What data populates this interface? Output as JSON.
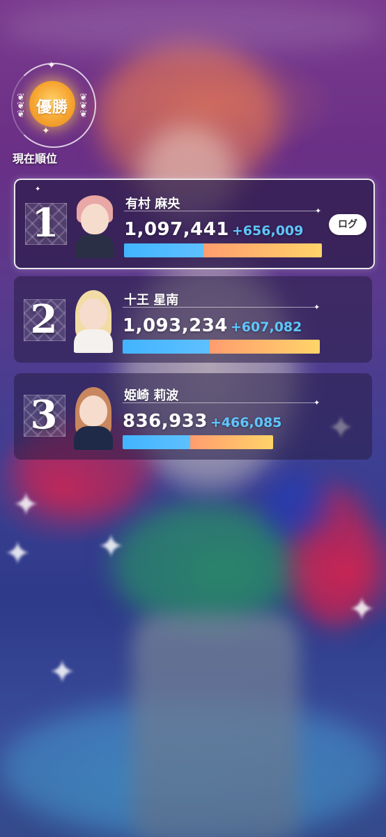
{
  "badge": {
    "medal_text": "優勝",
    "caption": "現在順位"
  },
  "log_button": "ログ",
  "rankings": [
    {
      "rank": "1",
      "name": "有村 麻央",
      "score": "1,097,441",
      "delta": "+656,009",
      "bar_total": 1.0,
      "bar_blue_fraction": 0.4
    },
    {
      "rank": "2",
      "name": "十王 星南",
      "score": "1,093,234",
      "delta": "+607,082",
      "bar_total": 0.996,
      "bar_blue_fraction": 0.44
    },
    {
      "rank": "3",
      "name": "姫崎 莉波",
      "score": "836,933",
      "delta": "+466,085",
      "bar_total": 0.762,
      "bar_blue_fraction": 0.45
    }
  ],
  "colors": {
    "bar_blue": "#42b4ff",
    "bar_orange": "#ff9d6e",
    "bar_yellow": "#ffd46a",
    "delta_text": "#5fc6ff"
  }
}
